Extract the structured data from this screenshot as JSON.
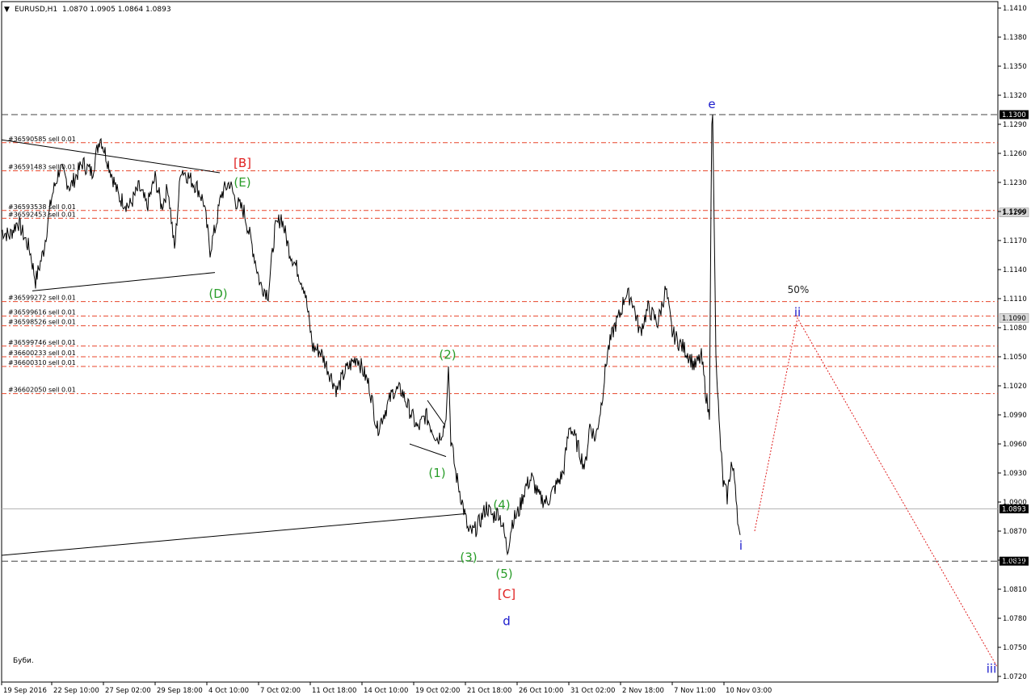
{
  "header": {
    "symbol": "EURUSD,H1",
    "ohlc": "1.0870 1.0905 1.0864 1.0893"
  },
  "signature": "Буби.",
  "colors": {
    "background": "#ffffff",
    "price_line": "#000000",
    "order_line": "#e8452a",
    "green_label": "#2a9d2a",
    "red_label": "#e02020",
    "blue_label": "#1a1acc",
    "forecast": "#e02020"
  },
  "chart_data": {
    "type": "line",
    "title": "EURUSD,H1",
    "xlabel": "",
    "ylabel": "",
    "ylim": [
      1.0715,
      1.1415
    ],
    "grid": false,
    "y_ticks": [
      "1.1410",
      "1.1380",
      "1.1350",
      "1.1320",
      "1.1290",
      "1.1260",
      "1.1230",
      "1.1200",
      "1.1170",
      "1.1140",
      "1.1110",
      "1.1080",
      "1.1050",
      "1.1020",
      "1.0990",
      "1.0960",
      "1.0930",
      "1.0900",
      "1.0870",
      "1.0840",
      "1.0810",
      "1.0780",
      "1.0750",
      "1.0720"
    ],
    "x_ticks": [
      {
        "label": "19 Sep 2016",
        "bar": 0
      },
      {
        "label": "22 Sep 10:00",
        "bar": 62
      },
      {
        "label": "27 Sep 02:00",
        "bar": 126
      },
      {
        "label": "29 Sep 18:00",
        "bar": 190
      },
      {
        "label": "4 Oct 10:00",
        "bar": 254
      },
      {
        "label": "7 Oct 02:00",
        "bar": 318
      },
      {
        "label": "11 Oct 18:00",
        "bar": 382
      },
      {
        "label": "14 Oct 10:00",
        "bar": 446
      },
      {
        "label": "19 Oct 02:00",
        "bar": 510
      },
      {
        "label": "21 Oct 18:00",
        "bar": 574
      },
      {
        "label": "26 Oct 10:00",
        "bar": 638
      },
      {
        "label": "31 Oct 02:00",
        "bar": 702
      },
      {
        "label": "2 Nov 18:00",
        "bar": 766
      },
      {
        "label": "7 Nov 11:00",
        "bar": 830
      },
      {
        "label": "10 Nov 03:00",
        "bar": 894
      }
    ],
    "price_keypoints": [
      [
        0,
        1.118
      ],
      [
        10,
        1.1175
      ],
      [
        20,
        1.119
      ],
      [
        35,
        1.116
      ],
      [
        42,
        1.1128
      ],
      [
        52,
        1.116
      ],
      [
        62,
        1.1215
      ],
      [
        72,
        1.1245
      ],
      [
        85,
        1.1225
      ],
      [
        100,
        1.125
      ],
      [
        112,
        1.124
      ],
      [
        122,
        1.1278
      ],
      [
        132,
        1.125
      ],
      [
        145,
        1.1215
      ],
      [
        158,
        1.1205
      ],
      [
        170,
        1.1225
      ],
      [
        180,
        1.1205
      ],
      [
        190,
        1.1235
      ],
      [
        198,
        1.1205
      ],
      [
        206,
        1.1225
      ],
      [
        214,
        1.116
      ],
      [
        222,
        1.1245
      ],
      [
        232,
        1.1235
      ],
      [
        242,
        1.1225
      ],
      [
        250,
        1.121
      ],
      [
        258,
        1.116
      ],
      [
        265,
        1.1185
      ],
      [
        272,
        1.1218
      ],
      [
        282,
        1.123
      ],
      [
        290,
        1.121
      ],
      [
        300,
        1.12
      ],
      [
        310,
        1.1165
      ],
      [
        320,
        1.1125
      ],
      [
        330,
        1.1115
      ],
      [
        338,
        1.118
      ],
      [
        346,
        1.1195
      ],
      [
        356,
        1.116
      ],
      [
        366,
        1.114
      ],
      [
        375,
        1.112
      ],
      [
        385,
        1.106
      ],
      [
        395,
        1.1055
      ],
      [
        405,
        1.1035
      ],
      [
        415,
        1.1015
      ],
      [
        425,
        1.1035
      ],
      [
        440,
        1.105
      ],
      [
        455,
        1.102
      ],
      [
        465,
        1.0975
      ],
      [
        475,
        1.0995
      ],
      [
        485,
        1.1015
      ],
      [
        495,
        1.1015
      ],
      [
        505,
        1.0995
      ],
      [
        515,
        1.0975
      ],
      [
        525,
        1.099
      ],
      [
        533,
        1.0975
      ],
      [
        540,
        1.0965
      ],
      [
        546,
        1.0975
      ],
      [
        550,
        1.0985
      ],
      [
        553,
        1.104
      ],
      [
        556,
        1.0965
      ],
      [
        562,
        1.093
      ],
      [
        570,
        1.09
      ],
      [
        578,
        1.0868
      ],
      [
        585,
        1.087
      ],
      [
        592,
        1.088
      ],
      [
        600,
        1.0895
      ],
      [
        608,
        1.0885
      ],
      [
        615,
        1.089
      ],
      [
        620,
        1.0876
      ],
      [
        626,
        1.085
      ],
      [
        632,
        1.088
      ],
      [
        640,
        1.089
      ],
      [
        648,
        1.0915
      ],
      [
        656,
        1.0925
      ],
      [
        665,
        1.0905
      ],
      [
        675,
        1.09
      ],
      [
        685,
        1.0915
      ],
      [
        695,
        1.093
      ],
      [
        703,
        1.098
      ],
      [
        710,
        1.0965
      ],
      [
        716,
        1.095
      ],
      [
        722,
        1.0935
      ],
      [
        728,
        1.098
      ],
      [
        735,
        1.0965
      ],
      [
        742,
        1.1
      ],
      [
        750,
        1.1055
      ],
      [
        758,
        1.108
      ],
      [
        766,
        1.1095
      ],
      [
        772,
        1.1115
      ],
      [
        780,
        1.111
      ],
      [
        790,
        1.1075
      ],
      [
        800,
        1.11
      ],
      [
        812,
        1.1085
      ],
      [
        822,
        1.112
      ],
      [
        830,
        1.1075
      ],
      [
        838,
        1.1065
      ],
      [
        848,
        1.1055
      ],
      [
        858,
        1.104
      ],
      [
        866,
        1.105
      ],
      [
        872,
        1.101
      ],
      [
        876,
        1.0985
      ],
      [
        878,
        1.121
      ],
      [
        879,
        1.129
      ],
      [
        880,
        1.13
      ],
      [
        882,
        1.118
      ],
      [
        884,
        1.106
      ],
      [
        888,
        1.098
      ],
      [
        893,
        1.092
      ],
      [
        898,
        1.0905
      ],
      [
        903,
        1.094
      ],
      [
        908,
        1.092
      ],
      [
        912,
        1.0875
      ],
      [
        914,
        1.0866
      ]
    ],
    "order_levels": [
      {
        "ticket": "#36590585 sell 0.01",
        "price": 1.1271
      },
      {
        "ticket": "#36591483 sell 0.01",
        "price": 1.1242
      },
      {
        "ticket": "#36593538 sell 0.01",
        "price": 1.1201
      },
      {
        "ticket": "#36592453 sell 0.01",
        "price": 1.1193
      },
      {
        "ticket": "#36599272 sell 0.01",
        "price": 1.1107
      },
      {
        "ticket": "#36599616 sell 0.01",
        "price": 1.1092
      },
      {
        "ticket": "#36598526 sell 0.01",
        "price": 1.1082
      },
      {
        "ticket": "#36599746 sell 0.01",
        "price": 1.1061
      },
      {
        "ticket": "#36600233 sell 0.01",
        "price": 1.105
      },
      {
        "ticket": "#36600310 sell 0.01",
        "price": 1.104
      },
      {
        "ticket": "#36602050 sell 0.01",
        "price": 1.1012
      }
    ],
    "hlines": [
      {
        "price": 1.13,
        "label": "1.1300",
        "style": "dash"
      },
      {
        "price": 1.0839,
        "label": "1.0839",
        "style": "dash"
      },
      {
        "price": 1.0893,
        "label": "1.0893",
        "style": "solid"
      }
    ],
    "price_tags": [
      {
        "price": 1.1199,
        "label": "1.1199"
      },
      {
        "price": 1.109,
        "label": "1.1090"
      }
    ],
    "trendlines": [
      {
        "from": [
          0,
          1.1274
        ],
        "to": [
          270,
          1.124
        ]
      },
      {
        "from": [
          38,
          1.1118
        ],
        "to": [
          264,
          1.1137
        ]
      },
      {
        "from": [
          0,
          1.0845
        ],
        "to": [
          575,
          1.0888
        ]
      },
      {
        "from": [
          505,
          1.096
        ],
        "to": [
          550,
          1.0947
        ]
      },
      {
        "from": [
          527,
          1.1005
        ],
        "to": [
          548,
          1.098
        ]
      }
    ],
    "forecast": [
      [
        932,
        1.087
      ],
      [
        985,
        1.109
      ],
      [
        1232,
        1.073
      ]
    ],
    "annotations": [
      {
        "text": "[B]",
        "bar": 298,
        "price": 1.125,
        "color": "red"
      },
      {
        "text": "(E)",
        "bar": 298,
        "price": 1.123,
        "color": "green"
      },
      {
        "text": "(D)",
        "bar": 268,
        "price": 1.1115,
        "color": "green"
      },
      {
        "text": "(2)",
        "bar": 552,
        "price": 1.1052,
        "color": "green"
      },
      {
        "text": "(1)",
        "bar": 539,
        "price": 1.093,
        "color": "green"
      },
      {
        "text": "(4)",
        "bar": 619,
        "price": 1.0897,
        "color": "green"
      },
      {
        "text": "(3)",
        "bar": 578,
        "price": 1.0843,
        "color": "green"
      },
      {
        "text": "(5)",
        "bar": 622,
        "price": 1.0826,
        "color": "green"
      },
      {
        "text": "[C]",
        "bar": 625,
        "price": 1.0805,
        "color": "red"
      },
      {
        "text": "d",
        "bar": 625,
        "price": 1.0777,
        "color": "blue"
      },
      {
        "text": "e",
        "bar": 879,
        "price": 1.1311,
        "color": "blue"
      },
      {
        "text": "i",
        "bar": 915,
        "price": 1.0855,
        "color": "blue"
      },
      {
        "text": "ii",
        "bar": 985,
        "price": 1.1096,
        "color": "blue"
      },
      {
        "text": "iii",
        "bar": 1225,
        "price": 1.0728,
        "color": "blue"
      },
      {
        "text": "50%",
        "bar": 986,
        "price": 1.112,
        "color": "black"
      }
    ]
  }
}
